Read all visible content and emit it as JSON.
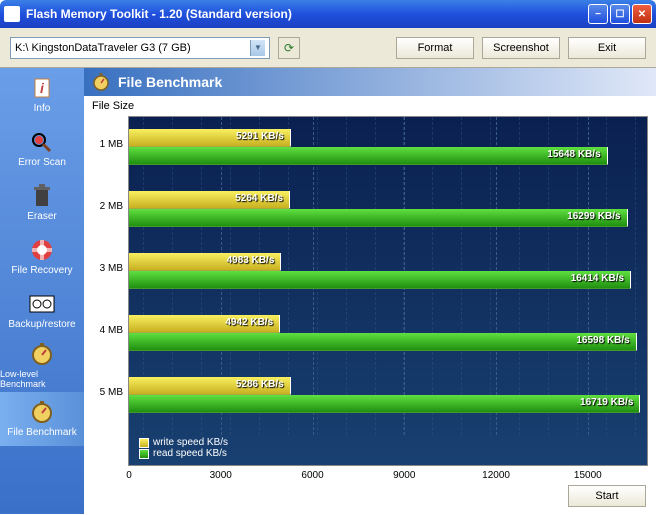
{
  "window": {
    "title": "Flash Memory Toolkit - 1.20 (Standard version)"
  },
  "toolbar": {
    "drive": "K:\\ KingstonDataTraveler G3 (7 GB)",
    "format": "Format",
    "screenshot": "Screenshot",
    "exit": "Exit"
  },
  "sidebar": {
    "items": [
      {
        "label": "Info"
      },
      {
        "label": "Error Scan"
      },
      {
        "label": "Eraser"
      },
      {
        "label": "File Recovery"
      },
      {
        "label": "Backup/restore"
      },
      {
        "label": "Low-level Benchmark"
      },
      {
        "label": "File Benchmark"
      }
    ]
  },
  "panel": {
    "title": "File Benchmark",
    "subtitle": "File Size",
    "legend_write": "write speed KB/s",
    "legend_read": "read speed KB/s"
  },
  "footer": {
    "start": "Start"
  },
  "chart_data": {
    "type": "bar",
    "categories": [
      "1 MB",
      "2 MB",
      "3 MB",
      "4 MB",
      "5 MB"
    ],
    "series": [
      {
        "name": "write speed KB/s",
        "values": [
          5291,
          5264,
          4983,
          4942,
          5286
        ]
      },
      {
        "name": "read speed KB/s",
        "values": [
          15648,
          16299,
          16414,
          16598,
          16719
        ]
      }
    ],
    "xlabel": "",
    "ylabel": "File Size",
    "x_ticks": [
      0,
      3000,
      6000,
      9000,
      12000,
      15000
    ],
    "xlim": [
      0,
      17000
    ]
  }
}
